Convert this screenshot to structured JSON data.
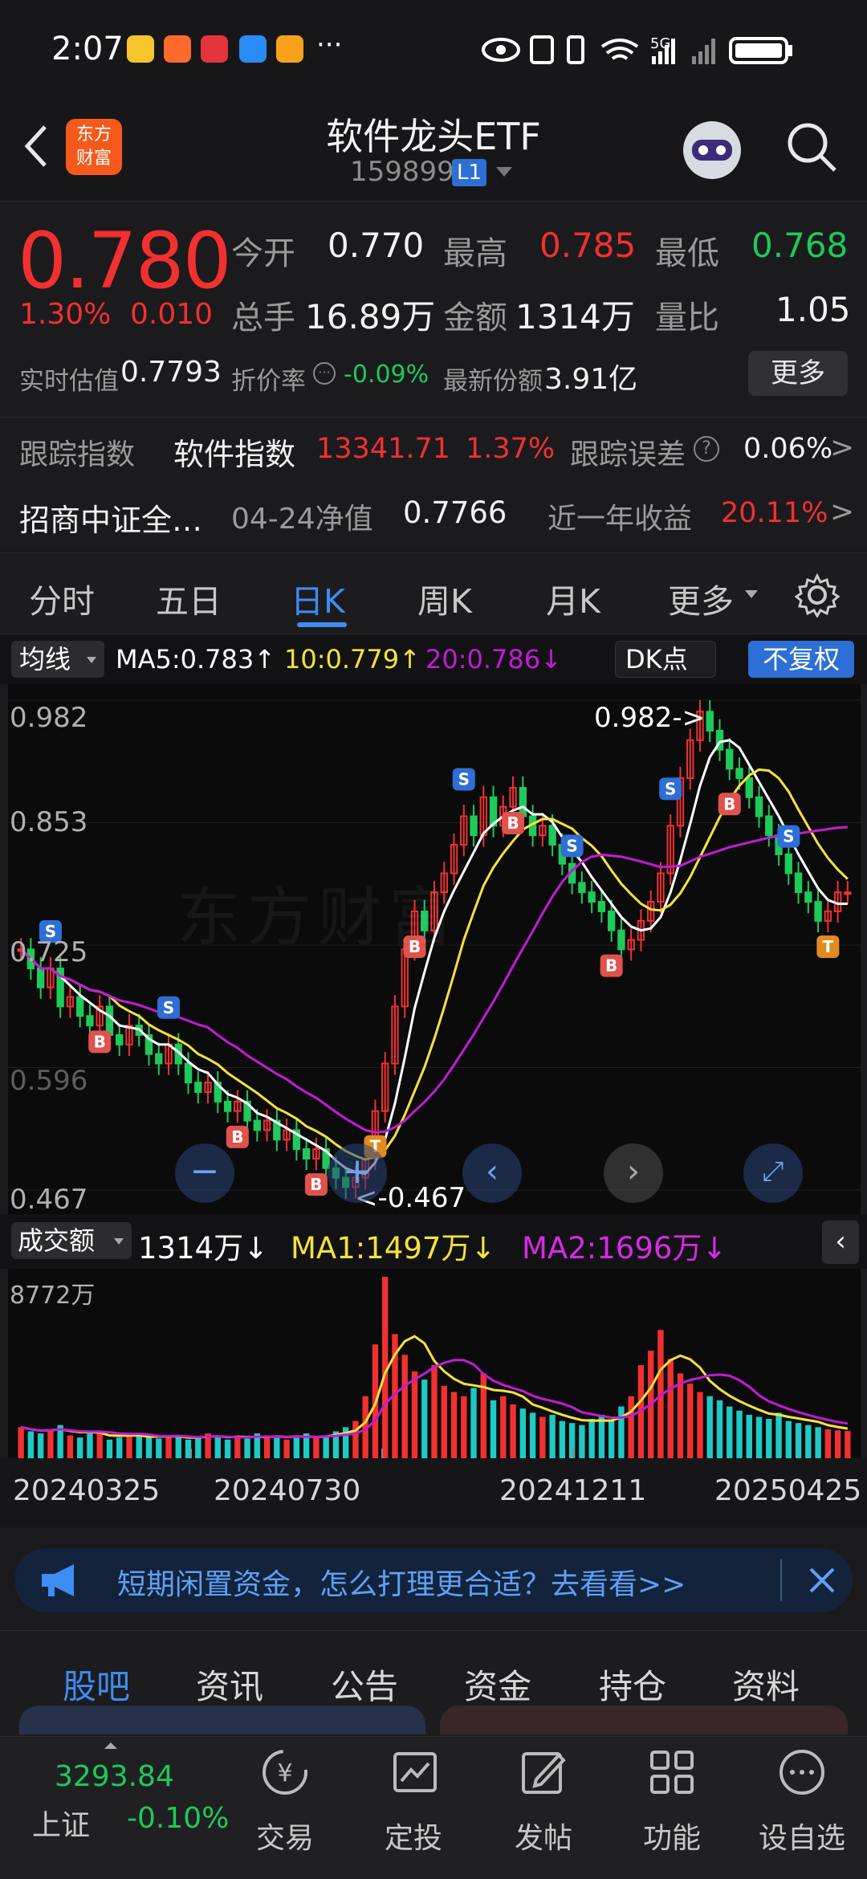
{
  "status_bar": {
    "time": "2:07",
    "more": "···",
    "network": "5G"
  },
  "header": {
    "title": "软件龙头ETF",
    "code": "159899",
    "level": "L1",
    "logo_text": "东方\n财富"
  },
  "quote": {
    "price": "0.780",
    "change_pct": "1.30%",
    "change": "0.010",
    "open_label": "今开",
    "open": "0.770",
    "high_label": "最高",
    "high": "0.785",
    "low_label": "最低",
    "low": "0.768",
    "volume_label": "总手",
    "volume": "16.89万",
    "amount_label": "金额",
    "amount": "1314万",
    "ratio_label": "量比",
    "ratio": "1.05",
    "iopv_label": "实时估值",
    "iopv": "0.7793",
    "discount_label": "折价率",
    "discount": "-0.09%",
    "shares_label": "最新份额",
    "shares": "3.91亿",
    "more_button": "更多"
  },
  "tracking": {
    "label": "跟踪指数",
    "index_name": "软件指数",
    "index_value": "13341.71",
    "index_pct": "1.37%",
    "error_label": "跟踪误差",
    "error_value": "0.06%",
    "fund_name": "招商中证全…",
    "nav_label": "04-24净值",
    "nav": "0.7766",
    "year_label": "近一年收益",
    "year_return": "20.11%"
  },
  "chart_tabs": {
    "items": [
      "分时",
      "五日",
      "日K",
      "周K",
      "月K",
      "更多"
    ],
    "active": "日K"
  },
  "ma_bar": {
    "selector": "均线",
    "ma5": "MA5:0.783↑",
    "ma10": "10:0.779↑",
    "ma20": "20:0.786↓",
    "dk": "DK点",
    "adjust": "不复权"
  },
  "kline": {
    "y_labels": [
      "0.982",
      "0.853",
      "0.725",
      "0.596",
      "0.467"
    ],
    "max_annot": "0.982->",
    "min_annot": "<-0.467",
    "watermark": "东方财富"
  },
  "volume_bar": {
    "selector": "成交额",
    "current": "1314万↓",
    "ma1": "MA1:1497万↓",
    "ma2": "MA2:1696万↓",
    "max_label": "8772万"
  },
  "dates": [
    "20240325",
    "20240730",
    "20241211",
    "20250425"
  ],
  "banner": {
    "text": "短期闲置资金，怎么打理更合适？去看看>>"
  },
  "bottom_tabs": {
    "items": [
      "股吧",
      "资讯",
      "公告",
      "资金",
      "持仓",
      "资料"
    ],
    "active": "股吧"
  },
  "nav": {
    "index_value": "3293.84",
    "index_name": "上证",
    "index_pct": "-0.10%",
    "items": [
      "交易",
      "定投",
      "发帖",
      "功能",
      "设自选"
    ]
  },
  "colors": {
    "up": "#f23030",
    "down": "#1fc95a",
    "accent": "#3d8df5",
    "ma5": "#ffffff",
    "ma10": "#f5e23a",
    "ma20": "#c21bd6"
  },
  "chart_data": {
    "type": "candlestick",
    "y_range": [
      0.467,
      0.982
    ],
    "start_date": "20240325",
    "end_date": "20250425",
    "close": [
      0.72,
      0.7,
      0.68,
      0.7,
      0.66,
      0.67,
      0.65,
      0.64,
      0.66,
      0.63,
      0.62,
      0.64,
      0.63,
      0.61,
      0.6,
      0.62,
      0.6,
      0.58,
      0.57,
      0.58,
      0.56,
      0.55,
      0.56,
      0.54,
      0.53,
      0.54,
      0.52,
      0.53,
      0.51,
      0.5,
      0.51,
      0.49,
      0.48,
      0.47,
      0.48,
      0.5,
      0.55,
      0.6,
      0.66,
      0.72,
      0.76,
      0.74,
      0.78,
      0.8,
      0.83,
      0.86,
      0.84,
      0.88,
      0.85,
      0.87,
      0.89,
      0.86,
      0.84,
      0.85,
      0.83,
      0.81,
      0.79,
      0.78,
      0.77,
      0.76,
      0.74,
      0.72,
      0.73,
      0.75,
      0.77,
      0.8,
      0.85,
      0.9,
      0.94,
      0.97,
      0.95,
      0.93,
      0.91,
      0.9,
      0.88,
      0.86,
      0.84,
      0.82,
      0.8,
      0.78,
      0.77,
      0.75,
      0.76,
      0.78,
      0.78
    ],
    "volume_wan": [
      1500,
      1300,
      1200,
      1400,
      1600,
      1100,
      1000,
      1200,
      1300,
      900,
      1000,
      1100,
      1200,
      1000,
      950,
      1050,
      1100,
      900,
      1000,
      1200,
      1100,
      900,
      1000,
      950,
      1200,
      1100,
      1000,
      900,
      1050,
      1200,
      1000,
      1100,
      1300,
      1500,
      1800,
      3000,
      5500,
      8772,
      6000,
      5000,
      4200,
      3800,
      4500,
      3500,
      3200,
      3000,
      3400,
      4100,
      2800,
      3000,
      2600,
      2400,
      2200,
      2000,
      2100,
      1800,
      1700,
      1600,
      1900,
      2100,
      1800,
      2500,
      3000,
      4500,
      5200,
      6200,
      4800,
      4100,
      3600,
      3200,
      3000,
      2800,
      2500,
      2300,
      2100,
      2000,
      1900,
      2200,
      1800,
      1700,
      1600,
      1500,
      1400,
      1350,
      1314
    ]
  }
}
